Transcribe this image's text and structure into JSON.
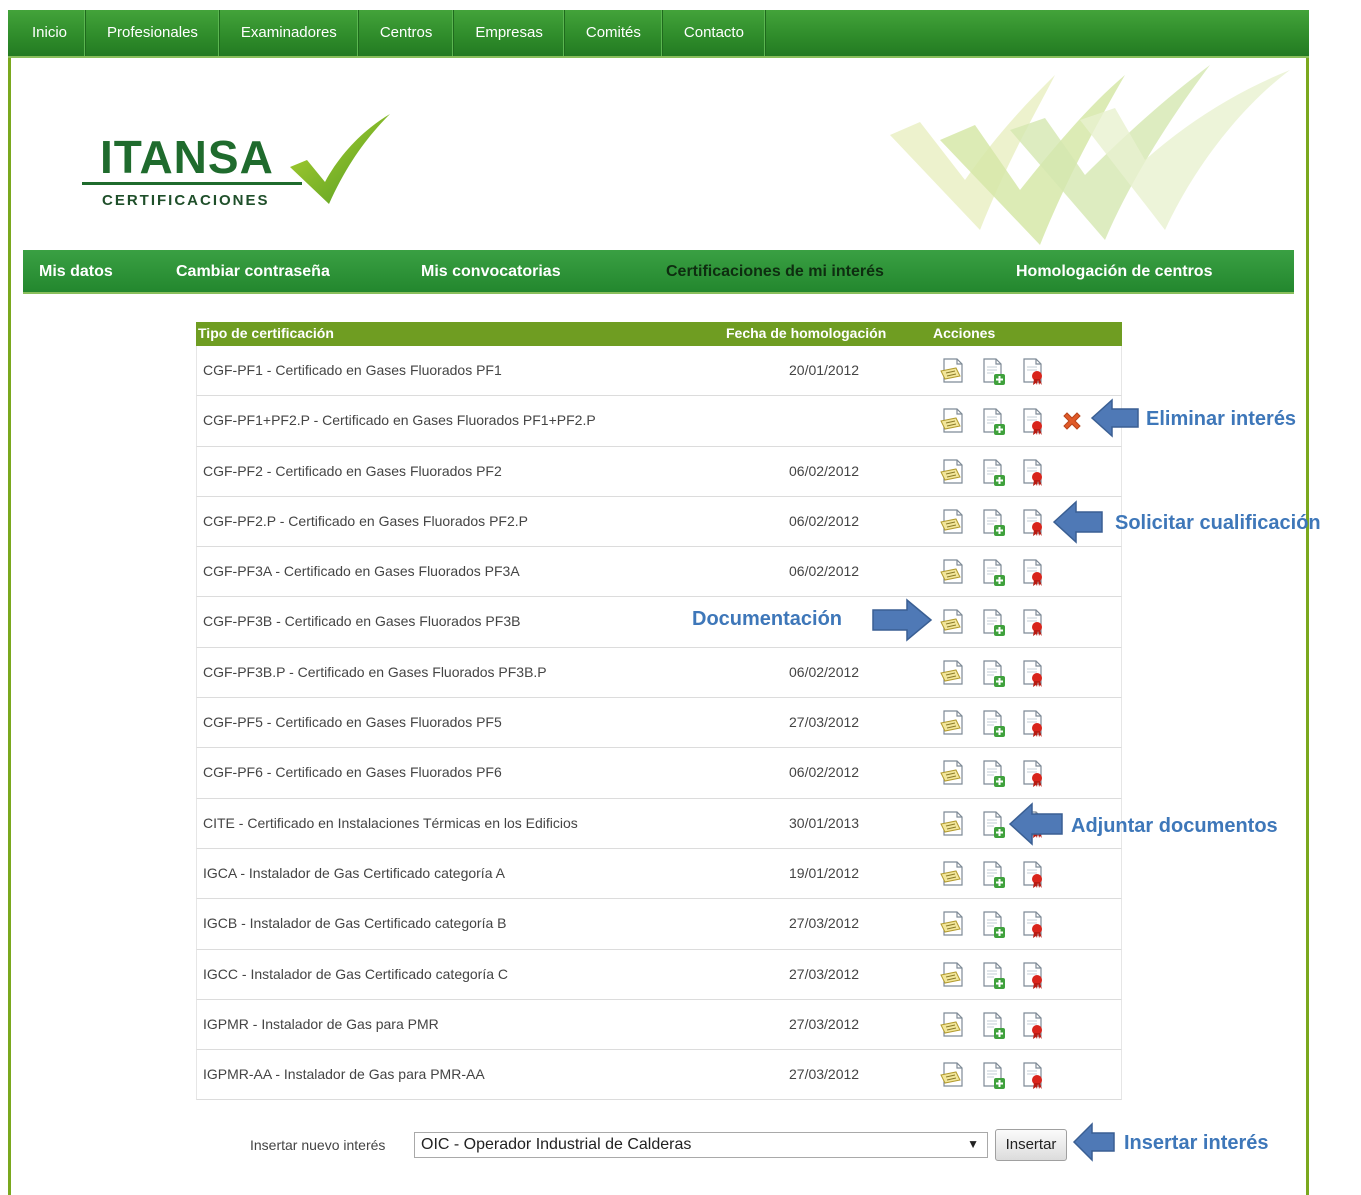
{
  "top_nav": [
    "Inicio",
    "Profesionales",
    "Examinadores",
    "Centros",
    "Empresas",
    "Comités",
    "Contacto"
  ],
  "logo": {
    "title": "ITANSA",
    "subtitle": "CERTIFICACIONES"
  },
  "member_nav": {
    "items": [
      "Mis datos",
      "Cambiar contraseña",
      "Mis convocatorias",
      "Certificaciones de mi interés",
      "Homologación de centros"
    ],
    "active": "Certificaciones de mi interés"
  },
  "table": {
    "headers": {
      "type": "Tipo de certificación",
      "date": "Fecha de homologación",
      "actions": "Acciones"
    },
    "rows": [
      {
        "name": "CGF-PF1 - Certificado en Gases Fluorados PF1",
        "date": "20/01/2012"
      },
      {
        "name": "CGF-PF1+PF2.P - Certificado en Gases Fluorados PF1+PF2.P",
        "date": ""
      },
      {
        "name": "CGF-PF2 - Certificado en Gases Fluorados PF2",
        "date": "06/02/2012"
      },
      {
        "name": "CGF-PF2.P - Certificado en Gases Fluorados PF2.P",
        "date": "06/02/2012"
      },
      {
        "name": "CGF-PF3A - Certificado en Gases Fluorados PF3A",
        "date": "06/02/2012"
      },
      {
        "name": "CGF-PF3B - Certificado en Gases Fluorados PF3B",
        "date": ""
      },
      {
        "name": "CGF-PF3B.P - Certificado en Gases Fluorados PF3B.P",
        "date": "06/02/2012"
      },
      {
        "name": "CGF-PF5 - Certificado en Gases Fluorados PF5",
        "date": "27/03/2012"
      },
      {
        "name": "CGF-PF6 - Certificado en Gases Fluorados PF6",
        "date": "06/02/2012"
      },
      {
        "name": "CITE - Certificado en Instalaciones Térmicas en los Edificios",
        "date": "30/01/2013"
      },
      {
        "name": "IGCA - Instalador de Gas Certificado categoría A",
        "date": "19/01/2012"
      },
      {
        "name": "IGCB - Instalador de Gas Certificado categoría B",
        "date": "27/03/2012"
      },
      {
        "name": "IGCC - Instalador de Gas Certificado categoría C",
        "date": "27/03/2012"
      },
      {
        "name": "IGPMR - Instalador de Gas para PMR",
        "date": "27/03/2012"
      },
      {
        "name": "IGPMR-AA - Instalador de Gas para PMR-AA",
        "date": "27/03/2012"
      }
    ],
    "row_icons": [
      "documentation-icon",
      "attach-document-icon",
      "request-certificate-icon"
    ],
    "delete_icon": "delete-x-icon"
  },
  "insert": {
    "label": "Insertar nuevo interés",
    "selected": "OIC - Operador Industrial de Calderas",
    "button": "Insertar"
  },
  "annotations": {
    "delete": "Eliminar interés",
    "request": "Solicitar cualificación",
    "documentation": "Documentación",
    "attach": "Adjuntar documentos",
    "insert": "Insertar interés"
  },
  "colors": {
    "nav_green": "#2e8b2a",
    "table_header": "#6f9d22",
    "callout_blue": "#3e77b9",
    "delete_red": "#e05a28"
  }
}
